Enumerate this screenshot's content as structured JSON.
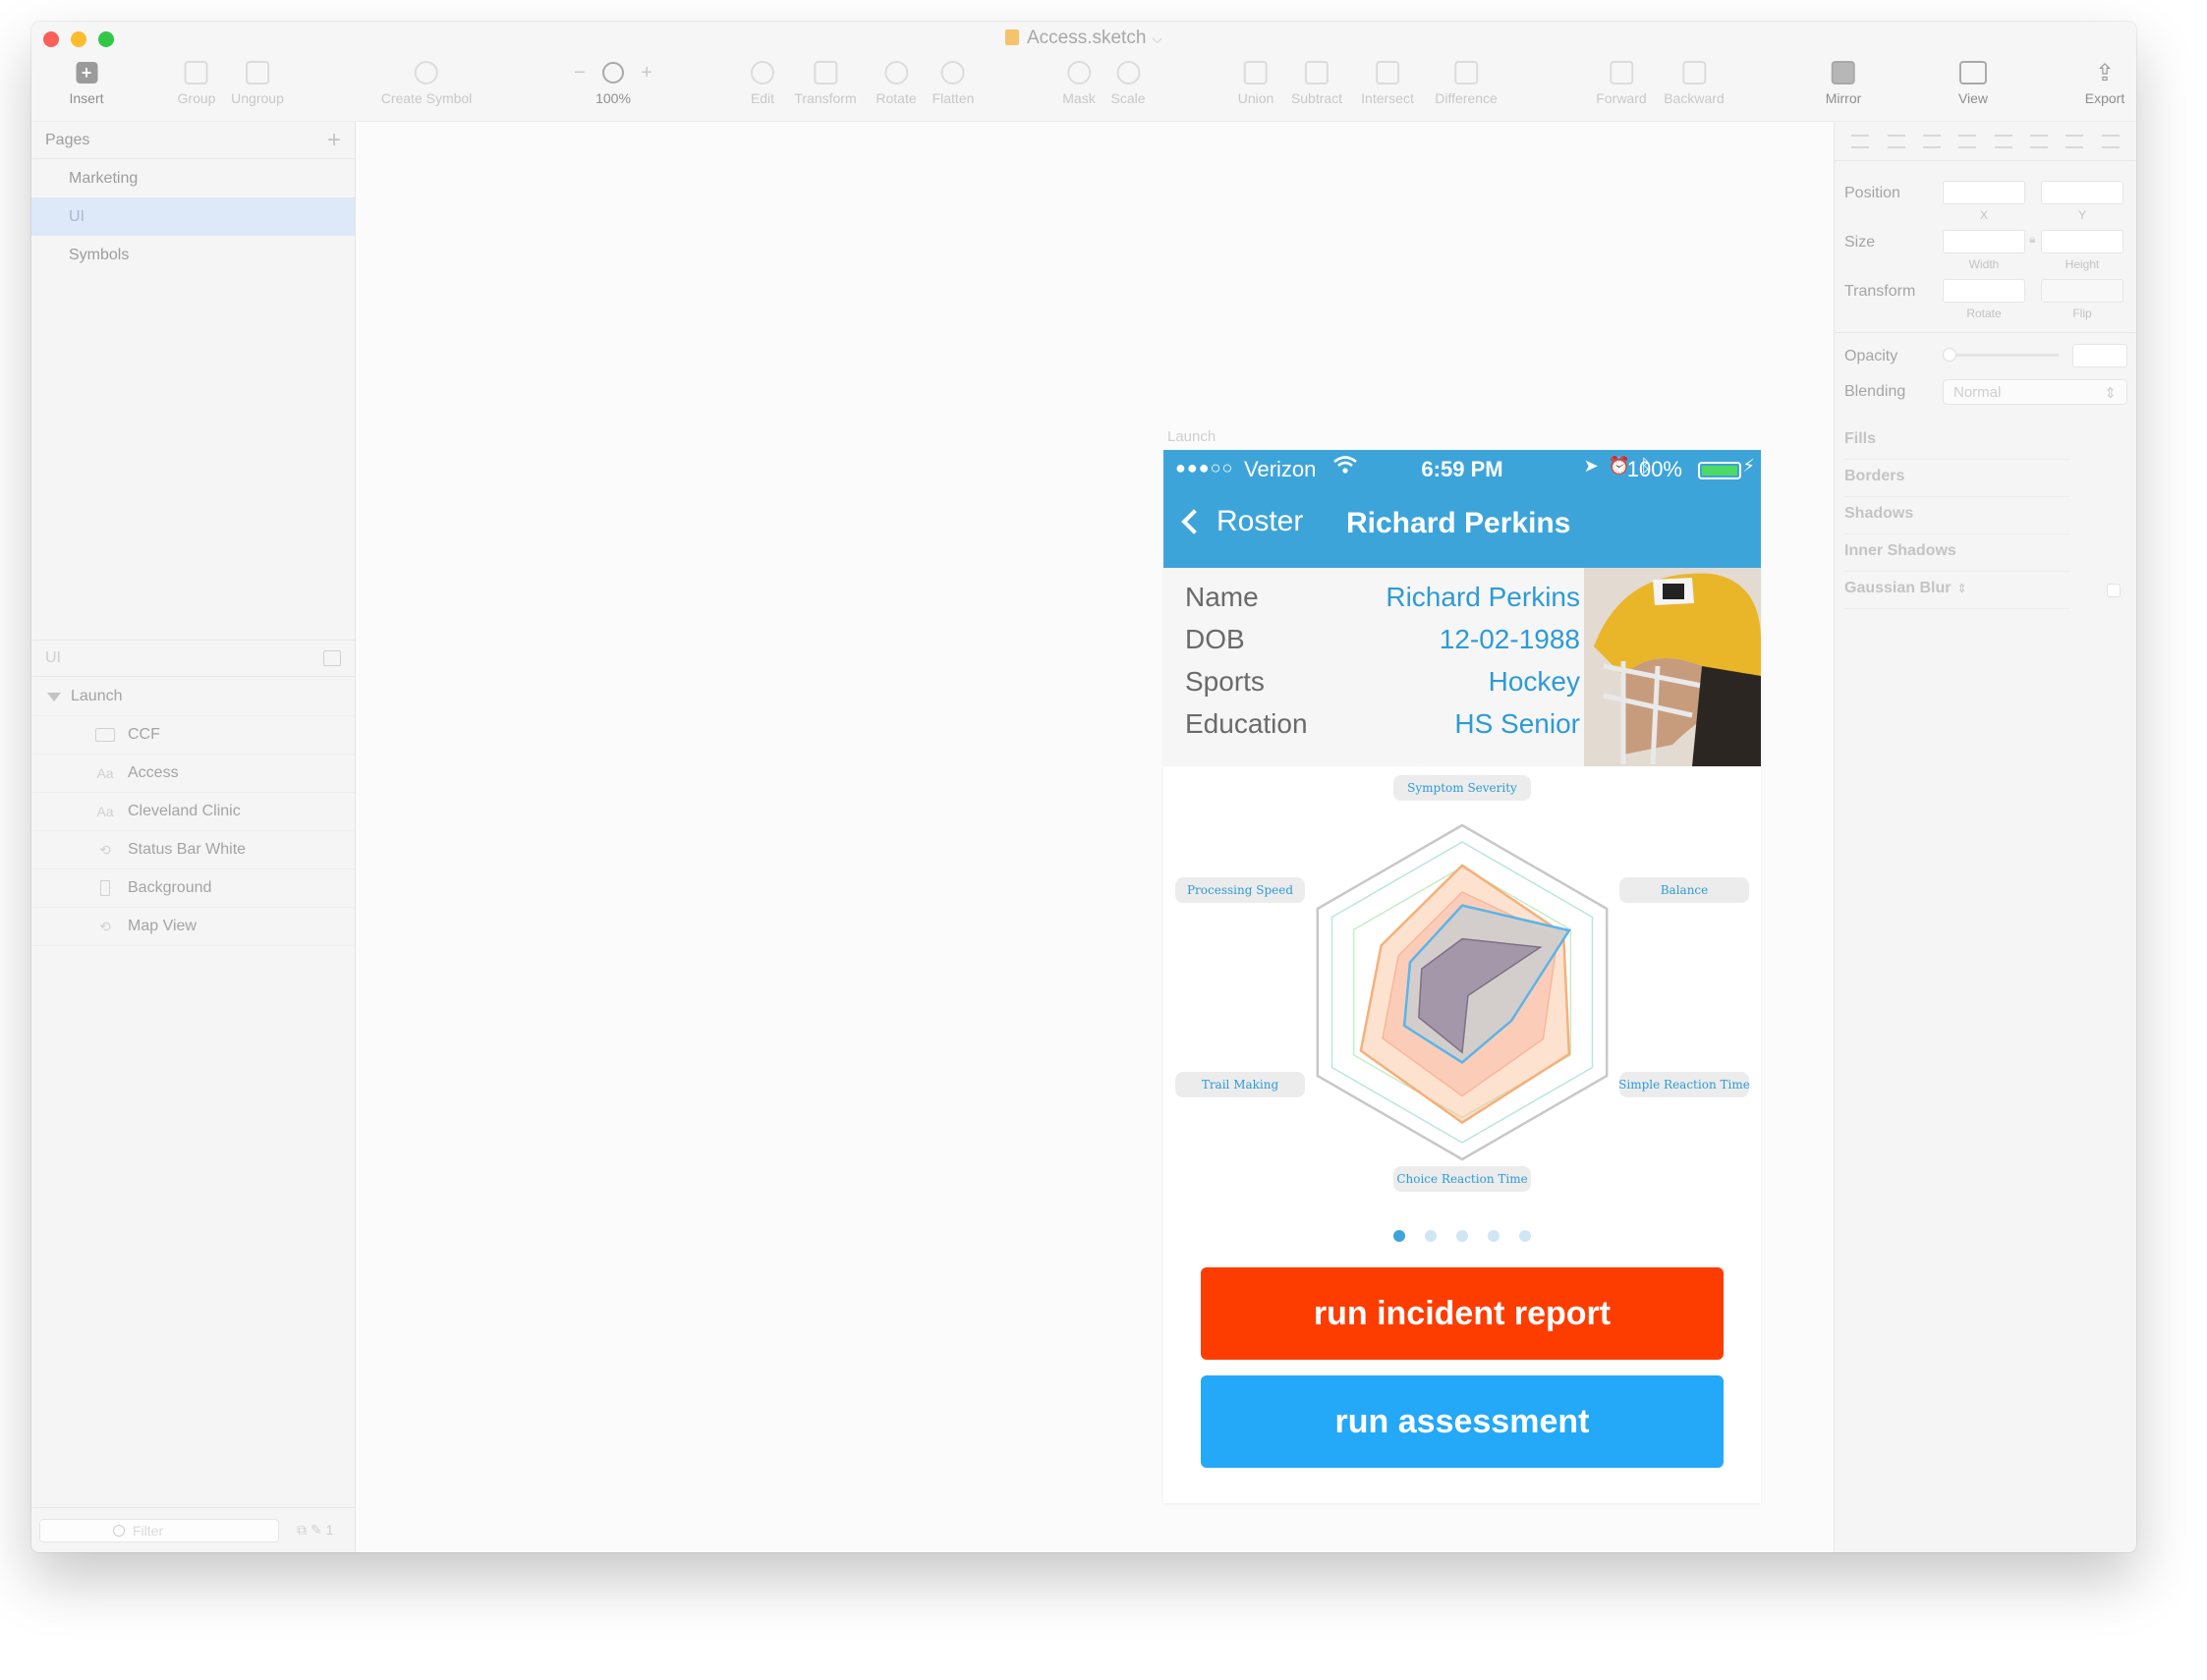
{
  "window": {
    "title": "Access.sketch"
  },
  "toolbar": {
    "items": [
      {
        "label": "Insert"
      },
      {
        "label": "Group"
      },
      {
        "label": "Ungroup"
      },
      {
        "label": "Create Symbol"
      },
      {
        "label": "100%"
      },
      {
        "label": "Edit"
      },
      {
        "label": "Transform"
      },
      {
        "label": "Rotate"
      },
      {
        "label": "Flatten"
      },
      {
        "label": "Mask"
      },
      {
        "label": "Scale"
      },
      {
        "label": "Union"
      },
      {
        "label": "Subtract"
      },
      {
        "label": "Intersect"
      },
      {
        "label": "Difference"
      },
      {
        "label": "Forward"
      },
      {
        "label": "Backward"
      },
      {
        "label": "Mirror"
      },
      {
        "label": "View"
      },
      {
        "label": "Export"
      }
    ]
  },
  "pages": {
    "header": "Pages",
    "items": [
      {
        "label": "Marketing"
      },
      {
        "label": "UI"
      },
      {
        "label": "Symbols"
      }
    ],
    "selected": "UI"
  },
  "layers": {
    "header": "UI",
    "group": "Launch",
    "items": [
      {
        "label": "CCF",
        "icon": "image-icon"
      },
      {
        "label": "Access",
        "icon": "text-icon"
      },
      {
        "label": "Cleveland Clinic",
        "icon": "text-icon"
      },
      {
        "label": "Status Bar White",
        "icon": "symbol-icon"
      },
      {
        "label": "Background",
        "icon": "rectangle-icon"
      },
      {
        "label": "Map View",
        "icon": "symbol-icon"
      }
    ],
    "filter_placeholder": "Filter",
    "filter_count": "1"
  },
  "inspector": {
    "position_label": "Position",
    "x_label": "X",
    "y_label": "Y",
    "size_label": "Size",
    "width_label": "Width",
    "height_label": "Height",
    "transform_label": "Transform",
    "rotate_label": "Rotate",
    "flip_label": "Flip",
    "opacity_label": "Opacity",
    "blending_label": "Blending",
    "blending_value": "Normal",
    "sections": [
      "Fills",
      "Borders",
      "Shadows",
      "Inner Shadows",
      "Gaussian Blur"
    ]
  },
  "artboard": {
    "name": "Launch",
    "status": {
      "dots": "●●●○○",
      "carrier": "Verizon",
      "time": "6:59 PM",
      "battery": "100%",
      "battery_level": 1.0
    },
    "nav": {
      "back_label": "Roster",
      "title": "Richard Perkins"
    },
    "profile": [
      {
        "key": "Name",
        "value": "Richard Perkins"
      },
      {
        "key": "DOB",
        "value": "12-02-1988"
      },
      {
        "key": "Sports",
        "value": "Hockey"
      },
      {
        "key": "Education",
        "value": "HS Senior"
      }
    ],
    "radar": {
      "axes": [
        "Symptom Severity",
        "Balance",
        "Simple  Reaction Time",
        "Choice Reaction Time",
        "Trail Making",
        "Processing Speed"
      ]
    },
    "pager": {
      "count": 5,
      "active": 0
    },
    "buttons": {
      "incident": "run incident report",
      "assessment": "run assessment"
    }
  },
  "colors": {
    "accent": "#3da4d9",
    "incident": "#fd3d00",
    "assess": "#24a8f8",
    "value_text": "#2d9bd6"
  }
}
